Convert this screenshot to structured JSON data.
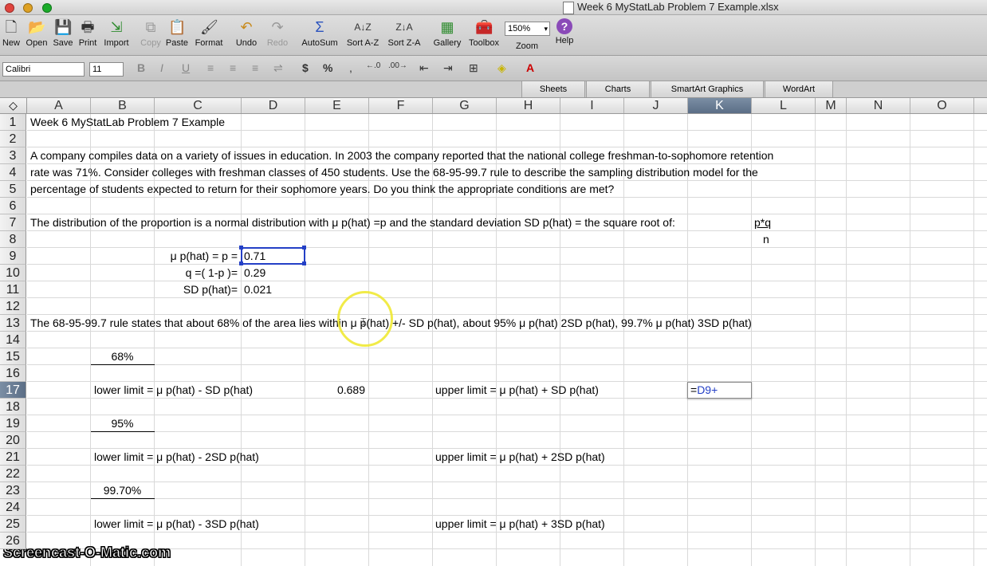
{
  "window": {
    "title": "Week 6 MyStatLab Problem 7 Example.xlsx"
  },
  "toolbar": {
    "new": "New",
    "open": "Open",
    "save": "Save",
    "print": "Print",
    "import": "Import",
    "copy": "Copy",
    "paste": "Paste",
    "format": "Format",
    "undo": "Undo",
    "redo": "Redo",
    "autosum": "AutoSum",
    "sort_az": "Sort A-Z",
    "sort_za": "Sort Z-A",
    "gallery": "Gallery",
    "toolbox": "Toolbox",
    "zoom_label": "Zoom",
    "zoom_value": "150%",
    "help": "Help"
  },
  "format_bar": {
    "font_name": "Calibri",
    "font_size": "11"
  },
  "ribbon_tabs": [
    "Sheets",
    "Charts",
    "SmartArt Graphics",
    "WordArt"
  ],
  "columns": [
    "A",
    "B",
    "C",
    "D",
    "E",
    "F",
    "G",
    "H",
    "I",
    "J",
    "K",
    "L",
    "M",
    "N",
    "O"
  ],
  "selected_column": "K",
  "rows": [
    "1",
    "2",
    "3",
    "4",
    "5",
    "6",
    "7",
    "8",
    "9",
    "10",
    "11",
    "12",
    "13",
    "14",
    "15",
    "16",
    "17",
    "18",
    "19",
    "20",
    "21",
    "22",
    "23",
    "24",
    "25",
    "26"
  ],
  "selected_row": "17",
  "cells": {
    "r1": "Week 6 MyStatLab Problem 7 Example",
    "r3": "A company compiles data on a variety of issues in education. In 2003 the company reported that the national college freshman-to-sophomore retention",
    "r4": "rate was 71%. Consider colleges with freshman classes of 450 students. Use the 68-95-99.7 rule to describe the sampling distribution model for the",
    "r5": "percentage of students expected to return for their sophomore years. Do you think the appropriate conditions are met?",
    "r7": "The distribution of the proportion is a normal distribution with μ p(hat) =p and the standard deviation SD p(hat) = the square root of:",
    "l7": "p*q",
    "l8": "n",
    "c9": "μ p(hat) = p =",
    "d9": "0.71",
    "c10": "q =( 1-p )=",
    "d10": "0.29",
    "c11": "SD p(hat)=",
    "d11": "0.021",
    "r13": "The 68-95-99.7 rule states that about 68% of the area lies within μ p(hat) +/- SD p(hat), about 95% μ p(hat) 2SD p(hat), 99.7% μ p(hat) 3SD p(hat)",
    "b15": "68%",
    "b17": "lower limit = μ p(hat) - SD p(hat)",
    "e17": "0.689",
    "g17": "upper limit =  μ p(hat) + SD p(hat)",
    "k17": "=D9+",
    "b19": "95%",
    "b21": "lower limit = μ p(hat) - 2SD p(hat)",
    "g21": "upper limit =  μ p(hat) + 2SD p(hat)",
    "b23": "99.70%",
    "b25": "lower limit = μ p(hat) - 3SD p(hat)",
    "g25": "upper limit =  μ p(hat) + 3SD p(hat)"
  },
  "watermark": "Screencast-O-Matic.com",
  "colors": {
    "selection": "#2440c6",
    "header_selected": "#6a7d95",
    "cursor_ring": "#eee828"
  }
}
